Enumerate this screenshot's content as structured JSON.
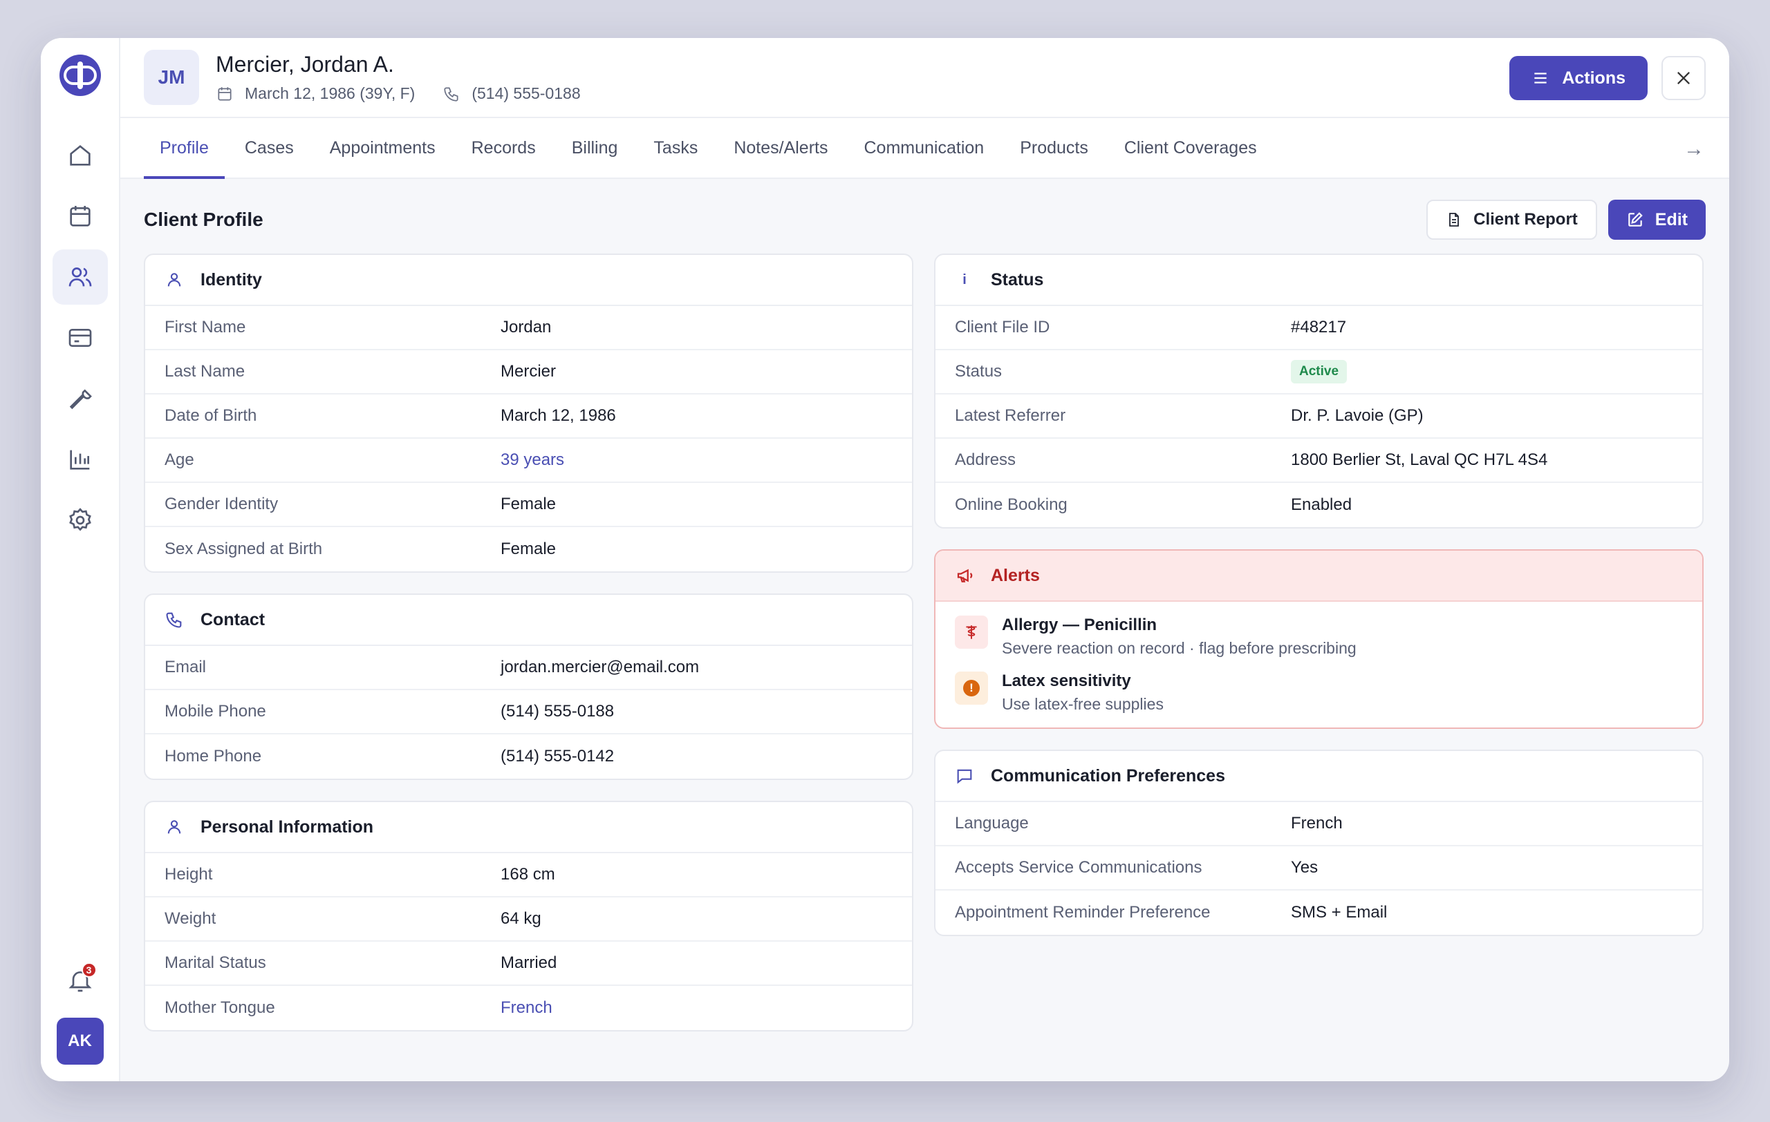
{
  "sidebar": {
    "nav": [
      "home-icon",
      "calendar-icon",
      "users-icon",
      "card-icon",
      "wrench-icon",
      "chart-icon",
      "gear-icon"
    ],
    "active_index": 2,
    "notifications_count": "3",
    "user_initials": "AK"
  },
  "header": {
    "initials": "JM",
    "name": "Mercier, Jordan A.",
    "dob": "March 12, 1986 (39Y, F)",
    "phone": "(514) 555-0188",
    "actions_label": "Actions"
  },
  "tabs": [
    "Profile",
    "Cases",
    "Appointments",
    "Records",
    "Billing",
    "Tasks",
    "Notes/Alerts",
    "Communication",
    "Products",
    "Client Coverages"
  ],
  "page": {
    "title": "Client Profile",
    "report_label": "Client Report",
    "edit_label": "Edit"
  },
  "identity": {
    "title": "Identity",
    "rows": [
      {
        "label": "First Name",
        "value": "Jordan"
      },
      {
        "label": "Last Name",
        "value": "Mercier"
      },
      {
        "label": "Date of Birth",
        "value": "March 12, 1986"
      },
      {
        "label": "Age",
        "value": "39 years"
      },
      {
        "label": "Gender Identity",
        "value": "Female"
      },
      {
        "label": "Sex Assigned at Birth",
        "value": "Female"
      }
    ]
  },
  "contact": {
    "title": "Contact",
    "rows": [
      {
        "label": "Email",
        "value": "jordan.mercier@email.com"
      },
      {
        "label": "Mobile Phone",
        "value": "(514) 555-0188"
      },
      {
        "label": "Home Phone",
        "value": "(514) 555-0142"
      }
    ]
  },
  "personal": {
    "title": "Personal Information",
    "rows": [
      {
        "label": "Height",
        "value": "168 cm"
      },
      {
        "label": "Weight",
        "value": "64 kg"
      },
      {
        "label": "Marital Status",
        "value": "Married"
      },
      {
        "label": "Mother Tongue",
        "value": "French"
      }
    ]
  },
  "status": {
    "title": "Status",
    "rows": [
      {
        "label": "Client File ID",
        "value": "#48217"
      },
      {
        "label": "Status",
        "value": "Active"
      },
      {
        "label": "Latest Referrer",
        "value": "Dr. P. Lavoie (GP)"
      },
      {
        "label": "Address",
        "value": "1800 Berlier St, Laval QC H7L 4S4"
      },
      {
        "label": "Online Booking",
        "value": "Enabled"
      }
    ]
  },
  "alerts": {
    "title": "Alerts",
    "items": [
      {
        "title": "Allergy — Penicillin",
        "desc": "Severe reaction on record · flag before prescribing"
      },
      {
        "title": "Latex sensitivity",
        "desc": "Use latex-free supplies"
      }
    ]
  },
  "comm": {
    "title": "Communication Preferences",
    "rows": [
      {
        "label": "Language",
        "value": "French"
      },
      {
        "label": "Accepts Service Communications",
        "value": "Yes"
      },
      {
        "label": "Appointment Reminder Preference",
        "value": "SMS + Email"
      }
    ]
  },
  "colors": {
    "accent": "#4a47b9",
    "alert": "#c62828",
    "active_badge": "#1f8a4c"
  }
}
